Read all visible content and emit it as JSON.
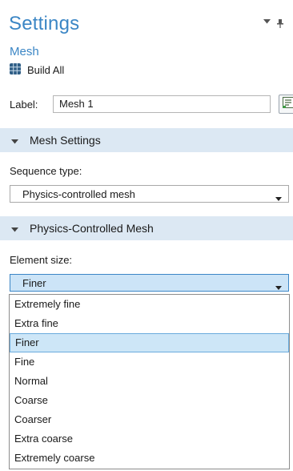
{
  "header": {
    "title": "Settings",
    "subtitle": "Mesh",
    "build_all_label": "Build All"
  },
  "label_field": {
    "label": "Label:",
    "value": "Mesh 1"
  },
  "mesh_settings": {
    "section_title": "Mesh Settings",
    "sequence_type_label": "Sequence type:",
    "sequence_type_value": "Physics-controlled mesh"
  },
  "physics_mesh": {
    "section_title": "Physics-Controlled Mesh",
    "element_size_label": "Element size:",
    "element_size_value": "Finer",
    "options": [
      "Extremely fine",
      "Extra fine",
      "Finer",
      "Fine",
      "Normal",
      "Coarse",
      "Coarser",
      "Extra coarse",
      "Extremely coarse"
    ],
    "selected_index": 2
  },
  "colors": {
    "accent": "#3b86c5",
    "section_bg": "#dce8f3",
    "selection_bg": "#cde6f7"
  },
  "icons": [
    "chevron-down-icon",
    "pin-icon",
    "build-all-icon",
    "edit-label-icon",
    "triangle-down-icon",
    "caret-down-icon"
  ]
}
